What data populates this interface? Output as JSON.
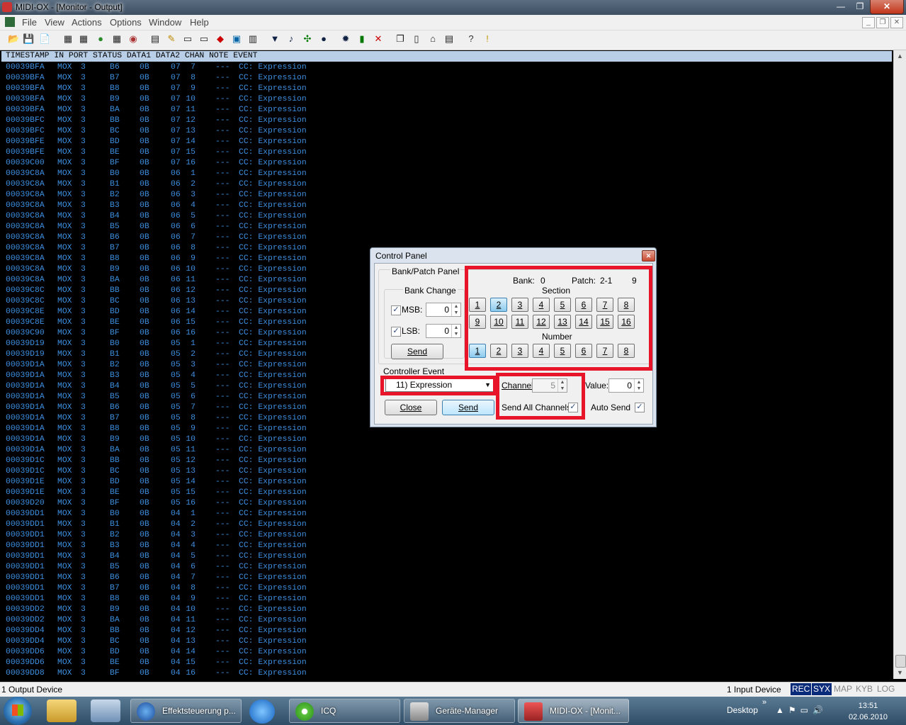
{
  "window": {
    "title": "MIDI-OX - [Monitor - Output]",
    "controls": {
      "minimize": "—",
      "maximize": "❐",
      "close": "✕"
    }
  },
  "menu": {
    "items": [
      "File",
      "View",
      "Actions",
      "Options",
      "Window",
      "Help"
    ],
    "mdi_controls": [
      "_",
      "❐",
      "✕"
    ]
  },
  "toolbar": {
    "icons": [
      "open-icon",
      "save-icon",
      "save-as-icon",
      "monitor-input-icon",
      "monitor-output-icon",
      "port-icon",
      "grid-icon",
      "counter-icon",
      "options-icon",
      "edit-icon",
      "keyboard-icon",
      "keyboard2-icon",
      "connect-icon",
      "sysex-icon",
      "device-icon",
      "filter-icon",
      "notes-icon",
      "routing-icon",
      "play-icon",
      "record-icon",
      "battery-icon",
      "stop-icon",
      "window-icon",
      "slider-icon",
      "panic-icon",
      "help-icon",
      "info-icon"
    ]
  },
  "monitor": {
    "header": "TIMESTAMP IN PORT STATUS DATA1 DATA2 CHAN NOTE EVENT",
    "rows": [
      [
        "00039BFA",
        "MOX",
        "3",
        "B6",
        "0B",
        "07",
        "7",
        "---",
        "CC: Expression"
      ],
      [
        "00039BFA",
        "MOX",
        "3",
        "B7",
        "0B",
        "07",
        "8",
        "---",
        "CC: Expression"
      ],
      [
        "00039BFA",
        "MOX",
        "3",
        "B8",
        "0B",
        "07",
        "9",
        "---",
        "CC: Expression"
      ],
      [
        "00039BFA",
        "MOX",
        "3",
        "B9",
        "0B",
        "07",
        "10",
        "---",
        "CC: Expression"
      ],
      [
        "00039BFA",
        "MOX",
        "3",
        "BA",
        "0B",
        "07",
        "11",
        "---",
        "CC: Expression"
      ],
      [
        "00039BFC",
        "MOX",
        "3",
        "BB",
        "0B",
        "07",
        "12",
        "---",
        "CC: Expression"
      ],
      [
        "00039BFC",
        "MOX",
        "3",
        "BC",
        "0B",
        "07",
        "13",
        "---",
        "CC: Expression"
      ],
      [
        "00039BFE",
        "MOX",
        "3",
        "BD",
        "0B",
        "07",
        "14",
        "---",
        "CC: Expression"
      ],
      [
        "00039BFE",
        "MOX",
        "3",
        "BE",
        "0B",
        "07",
        "15",
        "---",
        "CC: Expression"
      ],
      [
        "00039C00",
        "MOX",
        "3",
        "BF",
        "0B",
        "07",
        "16",
        "---",
        "CC: Expression"
      ],
      [
        "00039C8A",
        "MOX",
        "3",
        "B0",
        "0B",
        "06",
        "1",
        "---",
        "CC: Expression"
      ],
      [
        "00039C8A",
        "MOX",
        "3",
        "B1",
        "0B",
        "06",
        "2",
        "---",
        "CC: Expression"
      ],
      [
        "00039C8A",
        "MOX",
        "3",
        "B2",
        "0B",
        "06",
        "3",
        "---",
        "CC: Expression"
      ],
      [
        "00039C8A",
        "MOX",
        "3",
        "B3",
        "0B",
        "06",
        "4",
        "---",
        "CC: Expression"
      ],
      [
        "00039C8A",
        "MOX",
        "3",
        "B4",
        "0B",
        "06",
        "5",
        "---",
        "CC: Expression"
      ],
      [
        "00039C8A",
        "MOX",
        "3",
        "B5",
        "0B",
        "06",
        "6",
        "---",
        "CC: Expression"
      ],
      [
        "00039C8A",
        "MOX",
        "3",
        "B6",
        "0B",
        "06",
        "7",
        "---",
        "CC: Expression"
      ],
      [
        "00039C8A",
        "MOX",
        "3",
        "B7",
        "0B",
        "06",
        "8",
        "---",
        "CC: Expression"
      ],
      [
        "00039C8A",
        "MOX",
        "3",
        "B8",
        "0B",
        "06",
        "9",
        "---",
        "CC: Expression"
      ],
      [
        "00039C8A",
        "MOX",
        "3",
        "B9",
        "0B",
        "06",
        "10",
        "---",
        "CC: Expression"
      ],
      [
        "00039C8A",
        "MOX",
        "3",
        "BA",
        "0B",
        "06",
        "11",
        "---",
        "CC: Expression"
      ],
      [
        "00039C8C",
        "MOX",
        "3",
        "BB",
        "0B",
        "06",
        "12",
        "---",
        "CC: Expression"
      ],
      [
        "00039C8C",
        "MOX",
        "3",
        "BC",
        "0B",
        "06",
        "13",
        "---",
        "CC: Expression"
      ],
      [
        "00039C8E",
        "MOX",
        "3",
        "BD",
        "0B",
        "06",
        "14",
        "---",
        "CC: Expression"
      ],
      [
        "00039C8E",
        "MOX",
        "3",
        "BE",
        "0B",
        "06",
        "15",
        "---",
        "CC: Expression"
      ],
      [
        "00039C90",
        "MOX",
        "3",
        "BF",
        "0B",
        "06",
        "16",
        "---",
        "CC: Expression"
      ],
      [
        "00039D19",
        "MOX",
        "3",
        "B0",
        "0B",
        "05",
        "1",
        "---",
        "CC: Expression"
      ],
      [
        "00039D19",
        "MOX",
        "3",
        "B1",
        "0B",
        "05",
        "2",
        "---",
        "CC: Expression"
      ],
      [
        "00039D1A",
        "MOX",
        "3",
        "B2",
        "0B",
        "05",
        "3",
        "---",
        "CC: Expression"
      ],
      [
        "00039D1A",
        "MOX",
        "3",
        "B3",
        "0B",
        "05",
        "4",
        "---",
        "CC: Expression"
      ],
      [
        "00039D1A",
        "MOX",
        "3",
        "B4",
        "0B",
        "05",
        "5",
        "---",
        "CC: Expression"
      ],
      [
        "00039D1A",
        "MOX",
        "3",
        "B5",
        "0B",
        "05",
        "6",
        "---",
        "CC: Expression"
      ],
      [
        "00039D1A",
        "MOX",
        "3",
        "B6",
        "0B",
        "05",
        "7",
        "---",
        "CC: Expression"
      ],
      [
        "00039D1A",
        "MOX",
        "3",
        "B7",
        "0B",
        "05",
        "8",
        "---",
        "CC: Expression"
      ],
      [
        "00039D1A",
        "MOX",
        "3",
        "B8",
        "0B",
        "05",
        "9",
        "---",
        "CC: Expression"
      ],
      [
        "00039D1A",
        "MOX",
        "3",
        "B9",
        "0B",
        "05",
        "10",
        "---",
        "CC: Expression"
      ],
      [
        "00039D1A",
        "MOX",
        "3",
        "BA",
        "0B",
        "05",
        "11",
        "---",
        "CC: Expression"
      ],
      [
        "00039D1C",
        "MOX",
        "3",
        "BB",
        "0B",
        "05",
        "12",
        "---",
        "CC: Expression"
      ],
      [
        "00039D1C",
        "MOX",
        "3",
        "BC",
        "0B",
        "05",
        "13",
        "---",
        "CC: Expression"
      ],
      [
        "00039D1E",
        "MOX",
        "3",
        "BD",
        "0B",
        "05",
        "14",
        "---",
        "CC: Expression"
      ],
      [
        "00039D1E",
        "MOX",
        "3",
        "BE",
        "0B",
        "05",
        "15",
        "---",
        "CC: Expression"
      ],
      [
        "00039D20",
        "MOX",
        "3",
        "BF",
        "0B",
        "05",
        "16",
        "---",
        "CC: Expression"
      ],
      [
        "00039DD1",
        "MOX",
        "3",
        "B0",
        "0B",
        "04",
        "1",
        "---",
        "CC: Expression"
      ],
      [
        "00039DD1",
        "MOX",
        "3",
        "B1",
        "0B",
        "04",
        "2",
        "---",
        "CC: Expression"
      ],
      [
        "00039DD1",
        "MOX",
        "3",
        "B2",
        "0B",
        "04",
        "3",
        "---",
        "CC: Expression"
      ],
      [
        "00039DD1",
        "MOX",
        "3",
        "B3",
        "0B",
        "04",
        "4",
        "---",
        "CC: Expression"
      ],
      [
        "00039DD1",
        "MOX",
        "3",
        "B4",
        "0B",
        "04",
        "5",
        "---",
        "CC: Expression"
      ],
      [
        "00039DD1",
        "MOX",
        "3",
        "B5",
        "0B",
        "04",
        "6",
        "---",
        "CC: Expression"
      ],
      [
        "00039DD1",
        "MOX",
        "3",
        "B6",
        "0B",
        "04",
        "7",
        "---",
        "CC: Expression"
      ],
      [
        "00039DD1",
        "MOX",
        "3",
        "B7",
        "0B",
        "04",
        "8",
        "---",
        "CC: Expression"
      ],
      [
        "00039DD1",
        "MOX",
        "3",
        "B8",
        "0B",
        "04",
        "9",
        "---",
        "CC: Expression"
      ],
      [
        "00039DD2",
        "MOX",
        "3",
        "B9",
        "0B",
        "04",
        "10",
        "---",
        "CC: Expression"
      ],
      [
        "00039DD2",
        "MOX",
        "3",
        "BA",
        "0B",
        "04",
        "11",
        "---",
        "CC: Expression"
      ],
      [
        "00039DD4",
        "MOX",
        "3",
        "BB",
        "0B",
        "04",
        "12",
        "---",
        "CC: Expression"
      ],
      [
        "00039DD4",
        "MOX",
        "3",
        "BC",
        "0B",
        "04",
        "13",
        "---",
        "CC: Expression"
      ],
      [
        "00039DD6",
        "MOX",
        "3",
        "BD",
        "0B",
        "04",
        "14",
        "---",
        "CC: Expression"
      ],
      [
        "00039DD6",
        "MOX",
        "3",
        "BE",
        "0B",
        "04",
        "15",
        "---",
        "CC: Expression"
      ],
      [
        "00039DD8",
        "MOX",
        "3",
        "BF",
        "0B",
        "04",
        "16",
        "---",
        "CC: Expression"
      ]
    ]
  },
  "status_bar": {
    "output_devices": "1 Output Device",
    "input_devices": "1 Input Device",
    "indicators": [
      {
        "label": "REC",
        "active": true
      },
      {
        "label": "SYX",
        "active": true
      },
      {
        "label": "MAP",
        "active": false
      },
      {
        "label": "KYB",
        "active": false
      },
      {
        "label": "LOG",
        "active": false
      }
    ]
  },
  "control_panel": {
    "title": "Control Panel",
    "close": "✕",
    "bank_patch_panel": "Bank/Patch Panel",
    "bank_change": "Bank Change",
    "msb": {
      "label": "MSB:",
      "checked": true,
      "value": "0"
    },
    "lsb": {
      "label": "LSB:",
      "checked": true,
      "value": "0"
    },
    "bank_send": "Send",
    "bank_label": "Bank:",
    "bank_value": "0",
    "patch_label": "Patch:",
    "patch_value": "2-1",
    "patch_number": "9",
    "section_label": "Section",
    "section_buttons": [
      "1",
      "2",
      "3",
      "4",
      "5",
      "6",
      "7",
      "8",
      "9",
      "10",
      "11",
      "12",
      "13",
      "14",
      "15",
      "16"
    ],
    "section_selected": "2",
    "number_label": "Number",
    "number_buttons": [
      "1",
      "2",
      "3",
      "4",
      "5",
      "6",
      "7",
      "8"
    ],
    "number_selected": "1",
    "controller_event_label": "Controller Event",
    "controller_event_value": "11)    Expression",
    "channel_label": "Channel:",
    "channel_value": "5",
    "value_label": "Value:",
    "value_value": "0",
    "close_button": "Close",
    "send_button": "Send",
    "send_all_channels": "Send All Channels",
    "send_all_checked": true,
    "auto_send": "Auto Send",
    "auto_send_checked": true
  },
  "taskbar": {
    "tasks": [
      {
        "label": "Effektsteuerung p..."
      },
      {
        "label": "ICQ"
      },
      {
        "label": "Geräte-Manager"
      },
      {
        "label": "MIDI-OX - [Monit..."
      }
    ],
    "desktop": "Desktop",
    "expand": "»",
    "time": "13:51",
    "date": "02.06.2010"
  },
  "colors": {
    "monitor_text": "#3d8fe0",
    "monitor_header": "#b9cfe8",
    "highlight_box": "#e8152a",
    "indicator_active": "#0a2a7a"
  }
}
